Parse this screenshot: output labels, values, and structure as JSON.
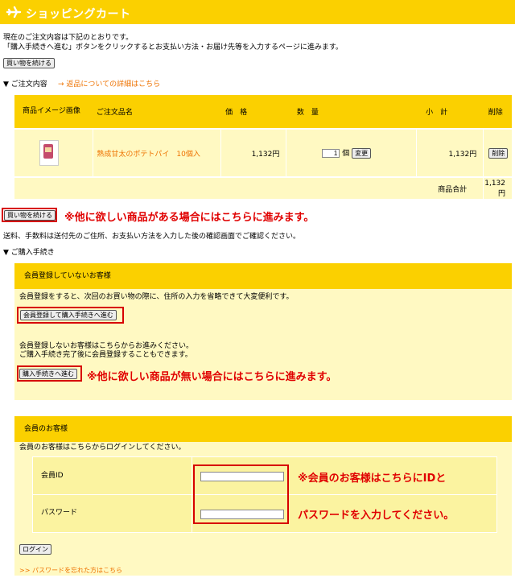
{
  "header": {
    "title": "ショッピングカート"
  },
  "intro": {
    "line1": "現在のご注文内容は下記のとおりです。",
    "line2": "「購入手続きへ進む」ボタンをクリックするとお支払い方法・お届け先等を入力するページに進みます。"
  },
  "continue_button": "買い物を続ける",
  "order_section": {
    "label": "▼ ご注文内容",
    "returns_link": "→ 返品についての詳細はこちら"
  },
  "cart": {
    "columns": [
      "商品イメージ画像",
      "ご注文品名",
      "価　格",
      "数　量",
      "小　計",
      "削除"
    ],
    "item": {
      "name": "熟成甘太のポテトパイ　10個入",
      "price": "1,132円",
      "quantity": "1",
      "unit": "個",
      "update_button": "変更",
      "subtotal": "1,132円",
      "delete_button": "削除"
    },
    "total_label": "商品合計",
    "total_value": "1,132円"
  },
  "annotation_continue": "※他に欲しい商品がある場合にはこちらに進みます。",
  "shipping_note": "送料、手数料は送付先のご住所、お支払い方法を入力した後の確認画面でご確認ください。",
  "purchase_section": {
    "label": "▼ ご購入手続き"
  },
  "guest": {
    "title": "会員登録していないお客様",
    "description": "会員登録をすると、次回のお買い物の際に、住所の入力を省略できて大変便利です。",
    "register_button": "会員登録して購入手続きへ進む",
    "note1": "会員登録しないお客様はこちらからお進みください。",
    "note2": "ご購入手続き完了後に会員登録することもできます。",
    "proceed_button": "購入手続きへ進む",
    "annotation": "※他に欲しい商品が無い場合にはこちらに進みます。"
  },
  "member": {
    "title": "会員のお客様",
    "description": "会員のお客様はこちらからログインしてください。",
    "id_label": "会員ID",
    "password_label": "パスワード",
    "id_value": "",
    "password_value": "",
    "annotation_line1": "※会員のお客様はこちらにIDと",
    "annotation_line2": "パスワードを入力してください。",
    "login_button": "ログイン",
    "forgot_link": ">> パスワードを忘れた方はこちら"
  },
  "colors": {
    "header_bg": "#fbd000",
    "light_bg": "#fff9c2",
    "annotation_red": "#e00000",
    "link_orange": "#ee7200"
  }
}
